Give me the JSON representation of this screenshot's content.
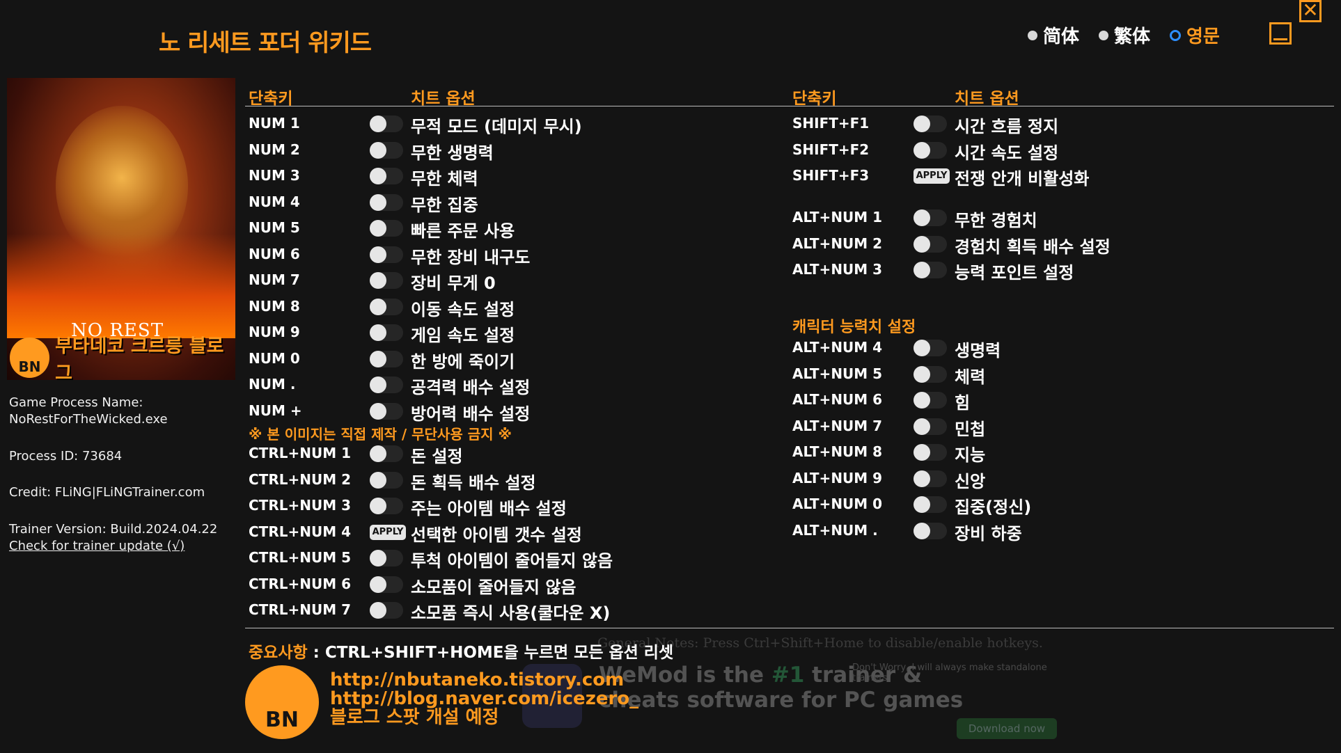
{
  "window": {
    "title": "노 리세트 포더 위키드",
    "languages": [
      {
        "label": "简体",
        "selected": false
      },
      {
        "label": "繁体",
        "selected": false
      },
      {
        "label": "영문",
        "selected": true
      }
    ],
    "minimize_icon": "minimize-icon",
    "close_icon": "close-icon",
    "close_glyph": "✕"
  },
  "colors": {
    "accent": "#ff9a1f",
    "background": "#141414",
    "toggle_knob": "#e6e6e6",
    "radio_selected": "#2d8fff"
  },
  "sidebar": {
    "game_logo_text": "NO REST",
    "banner_icon_text": "BN",
    "banner_text": "부타네코 크르릉 블로그",
    "process_name_label": "Game Process Name:",
    "process_name": "NoRestForTheWicked.exe",
    "process_id": "Process ID: 73684",
    "credit": "Credit: FLiNG|FLiNGTrainer.com",
    "trainer_version": "Trainer Version: Build.2024.04.22",
    "update_link": "Check for trainer update (√)"
  },
  "headers": {
    "hotkey": "단축키",
    "option": "치트 옵션"
  },
  "left_options": [
    {
      "hotkey": "NUM 1",
      "control": "toggle",
      "label": "무적 모드 (데미지 무시)"
    },
    {
      "hotkey": "NUM 2",
      "control": "toggle",
      "label": "무한 생명력"
    },
    {
      "hotkey": "NUM 3",
      "control": "toggle",
      "label": "무한 체력"
    },
    {
      "hotkey": "NUM 4",
      "control": "toggle",
      "label": "무한 집중"
    },
    {
      "hotkey": "NUM 5",
      "control": "toggle",
      "label": "빠른 주문 사용"
    },
    {
      "hotkey": "NUM 6",
      "control": "toggle",
      "label": "무한 장비 내구도"
    },
    {
      "hotkey": "NUM 7",
      "control": "toggle",
      "label": "장비 무게 0"
    },
    {
      "hotkey": "NUM 8",
      "control": "toggle",
      "label": "이동 속도 설정"
    },
    {
      "hotkey": "NUM 9",
      "control": "toggle",
      "label": "게임 속도 설정"
    },
    {
      "hotkey": "NUM 0",
      "control": "toggle",
      "label": "한 방에 죽이기"
    },
    {
      "hotkey": "NUM .",
      "control": "toggle",
      "label": "공격력 배수 설정"
    },
    {
      "hotkey": "NUM +",
      "control": "toggle",
      "label": "방어력 배수 설정"
    }
  ],
  "warning": "※ 본 이미지는 직접 제작 / 무단사용 금지 ※",
  "left_options2": [
    {
      "hotkey": "CTRL+NUM 1",
      "control": "toggle",
      "label": "돈 설정"
    },
    {
      "hotkey": "CTRL+NUM 2",
      "control": "toggle",
      "label": "돈 획득 배수 설정"
    },
    {
      "hotkey": "CTRL+NUM 3",
      "control": "toggle",
      "label": "주는 아이템 배수 설정"
    },
    {
      "hotkey": "CTRL+NUM 4",
      "control": "apply",
      "label": "선택한 아이템 갯수 설정"
    },
    {
      "hotkey": "CTRL+NUM 5",
      "control": "toggle",
      "label": "투척 아이템이 줄어들지 않음"
    },
    {
      "hotkey": "CTRL+NUM 6",
      "control": "toggle",
      "label": "소모품이 줄어들지 않음"
    },
    {
      "hotkey": "CTRL+NUM 7",
      "control": "toggle",
      "label": "소모품 즉시 사용(쿨다운 X)"
    }
  ],
  "right_options": [
    {
      "hotkey": "SHIFT+F1",
      "control": "toggle",
      "label": "시간 흐름 정지"
    },
    {
      "hotkey": "SHIFT+F2",
      "control": "toggle",
      "label": "시간 속도 설정"
    },
    {
      "hotkey": "SHIFT+F3",
      "control": "apply",
      "label": "전쟁 안개 비활성화"
    }
  ],
  "right_options2": [
    {
      "hotkey": "ALT+NUM 1",
      "control": "toggle",
      "label": "무한 경험치"
    },
    {
      "hotkey": "ALT+NUM 2",
      "control": "toggle",
      "label": "경험치 획득 배수 설정"
    },
    {
      "hotkey": "ALT+NUM 3",
      "control": "toggle",
      "label": "능력 포인트 설정"
    }
  ],
  "stats_section": "캐릭터 능력치 설정",
  "stats_options": [
    {
      "hotkey": "ALT+NUM 4",
      "control": "toggle",
      "label": "생명력"
    },
    {
      "hotkey": "ALT+NUM 5",
      "control": "toggle",
      "label": "체력"
    },
    {
      "hotkey": "ALT+NUM 6",
      "control": "toggle",
      "label": "힘"
    },
    {
      "hotkey": "ALT+NUM 7",
      "control": "toggle",
      "label": "민첩"
    },
    {
      "hotkey": "ALT+NUM 8",
      "control": "toggle",
      "label": "지능"
    },
    {
      "hotkey": "ALT+NUM 9",
      "control": "toggle",
      "label": "신앙"
    },
    {
      "hotkey": "ALT+NUM 0",
      "control": "toggle",
      "label": "집중(정신)"
    },
    {
      "hotkey": "ALT+NUM .",
      "control": "toggle",
      "label": "장비 하중"
    }
  ],
  "apply_label": "APPLY",
  "footer": {
    "note_label": "중요사항",
    "note_text": " : CTRL+SHIFT+HOME을 누르면 모든 옵션 리셋",
    "general_notes": "General Notes: Press Ctrl+Shift+Home to disable/enable hotkeys.",
    "logo_text": "BN",
    "url1": "http://nbutaneko.tistory.com",
    "url2": "http://blog.naver.com/icezero_",
    "url3": "블로그 스팟 개설 예정",
    "ad_line1": "WeMod is the ",
    "ad_highlight": "#1",
    "ad_line1b": " trainer &",
    "ad_line2": "cheats software for PC games",
    "ad_small": "Don't Worry, I will always make standalone trainers",
    "ad_button": "Download now"
  }
}
